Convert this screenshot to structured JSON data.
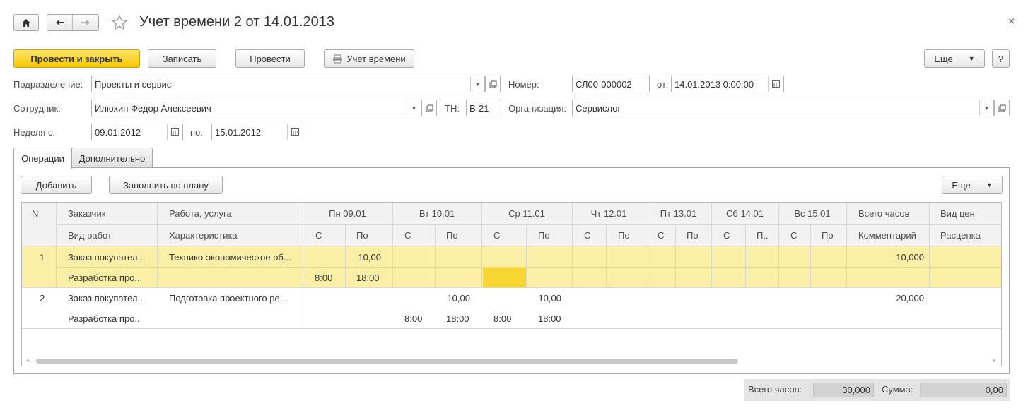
{
  "window": {
    "title": "Учет времени 2 от 14.01.2013",
    "close_glyph": "×"
  },
  "toolbar": {
    "post_close": "Провести и закрыть",
    "save": "Записать",
    "post": "Провести",
    "print": "Учет времени",
    "more": "Еще",
    "help": "?"
  },
  "form": {
    "department_label": "Подразделение:",
    "department_value": "Проекты и сервис",
    "number_label": "Номер:",
    "number_value": "СЛ00-000002",
    "date_label": "от:",
    "date_value": "14.01.2013  0:00:00",
    "employee_label": "Сотрудник:",
    "employee_value": "Илюхин Федор Алексеевич",
    "tn_label": "ТН:",
    "tn_value": "В-21",
    "org_label": "Организация:",
    "org_value": "Сервислог",
    "week_label": "Неделя с:",
    "week_from": "09.01.2012",
    "week_to_label": "по:",
    "week_to": "15.01.2012"
  },
  "tabs": [
    {
      "label": "Операции",
      "active": true
    },
    {
      "label": "Дополнительно",
      "active": false
    }
  ],
  "ops": {
    "add": "Добавить",
    "fill": "Заполнить по плану",
    "more": "Еще"
  },
  "table": {
    "h1": {
      "n": "N",
      "customer": "Заказчик",
      "work": "Работа, услуга",
      "mon": "Пн 09.01",
      "tue": "Вт 10.01",
      "wed": "Ср 11.01",
      "thu": "Чт 12.01",
      "fri": "Пт 13.01",
      "sat": "Сб 14.01",
      "sun": "Вс 15.01",
      "total": "Всего часов",
      "price_kind": "Вид цен"
    },
    "h2": {
      "work_type": "Вид работ",
      "characteristic": "Характеристика",
      "from": "С",
      "to": "По",
      "to_short": "П..",
      "comment": "Комментарий",
      "rate": "Расценка"
    },
    "rows": [
      {
        "n": "1",
        "customer": "Заказ покупател...",
        "work": "Технико-экономическое об...",
        "work_type": "Разработка про...",
        "mon_hours": "10,00",
        "mon_from": "8:00",
        "mon_to": "18:00",
        "total": "10,000"
      },
      {
        "n": "2",
        "customer": "Заказ покупател...",
        "work": "Подготовка проектного ре...",
        "work_type": "Разработка про...",
        "tue_hours": "10,00",
        "tue_from": "8:00",
        "tue_to": "18:00",
        "wed_hours": "10,00",
        "wed_from": "8:00",
        "wed_to": "18:00",
        "total": "20,000"
      }
    ]
  },
  "footer": {
    "total_hours_label": "Всего часов:",
    "total_hours_value": "30,000",
    "sum_label": "Сумма:",
    "sum_value": "0,00"
  },
  "colors": {
    "primary_button": "#f6c800",
    "selected_row": "#fbefa5",
    "active_cell": "#f8d733"
  }
}
